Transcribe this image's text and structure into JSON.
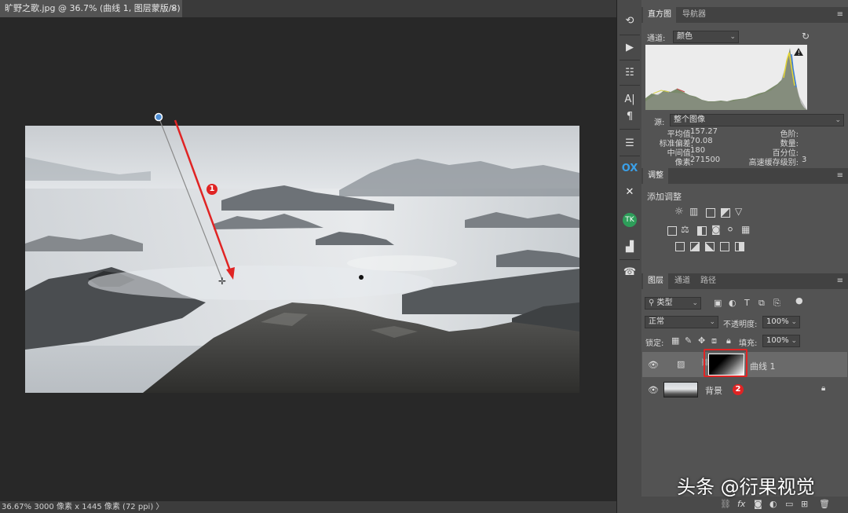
{
  "document": {
    "tab_title": "旷野之歌.jpg @ 36.7% (曲线 1, 图层蒙版/8) *",
    "close_glyph": "×"
  },
  "status_bar": {
    "zoom": "36.67%",
    "info": "3000 像素 x 1445 像素 (72 ppi)",
    "arrow": "〉"
  },
  "annotations": {
    "badge1": "1",
    "badge2": "2"
  },
  "histogram_panel": {
    "tabs": [
      "直方图",
      "导航器"
    ],
    "channel_label": "通道:",
    "channel_value": "颜色",
    "source_label": "源:",
    "source_value": "整个图像",
    "stats_left": [
      {
        "label": "平均值:",
        "value": "157.27"
      },
      {
        "label": "标准偏差:",
        "value": "70.08"
      },
      {
        "label": "中间值:",
        "value": "180"
      },
      {
        "label": "像素:",
        "value": "271500"
      }
    ],
    "stats_right": [
      {
        "label": "色阶:",
        "value": ""
      },
      {
        "label": "数量:",
        "value": ""
      },
      {
        "label": "百分位:",
        "value": ""
      },
      {
        "label": "高速缓存级别:",
        "value": "3"
      }
    ]
  },
  "adjustments_panel": {
    "tab": "调整",
    "add_label": "添加调整"
  },
  "layers_panel": {
    "tabs": [
      "图层",
      "通道",
      "路径"
    ],
    "filter_value": "类型",
    "blend_mode": "正常",
    "opacity_label": "不透明度:",
    "opacity_value": "100%",
    "lock_label": "锁定:",
    "fill_label": "填充:",
    "fill_value": "100%",
    "layers": [
      {
        "name": "曲线 1"
      },
      {
        "name": "背景"
      }
    ]
  },
  "watermark": "头条 @衍果视觉",
  "colors": {
    "accent_red": "#e02424",
    "panel_bg": "#535353",
    "canvas_bg": "#282828"
  }
}
